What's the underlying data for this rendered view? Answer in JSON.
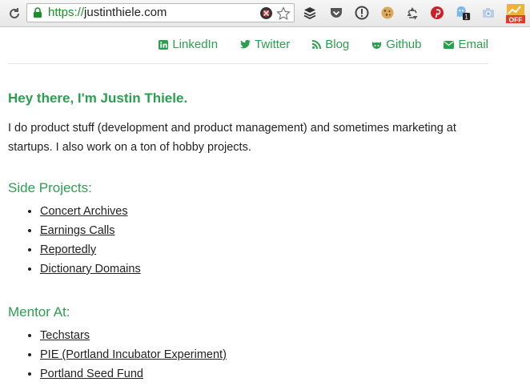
{
  "browser": {
    "url_scheme": "https://",
    "url_host": "justinthiele.com",
    "extensions": [
      {
        "name": "buffer-icon"
      },
      {
        "name": "pocket-icon"
      },
      {
        "name": "info-icon"
      },
      {
        "name": "cookie-icon"
      },
      {
        "name": "recycle-icon"
      },
      {
        "name": "pinterest-icon"
      },
      {
        "name": "ghost-icon",
        "badge": "1"
      },
      {
        "name": "camera-icon"
      },
      {
        "name": "chart-off-icon",
        "badge": "OFF"
      }
    ]
  },
  "nav": {
    "linkedin": "LinkedIn",
    "twitter": "Twitter",
    "blog": "Blog",
    "github": "Github",
    "email": "Email"
  },
  "colors": {
    "accent": "#2a9f4e",
    "url_scheme": "#1a8f2a"
  },
  "hero": {
    "heading": "Hey there, I'm Justin Thiele.",
    "intro": "I do product stuff (development and product management) and sometimes marketing at startups. I also work on a ton of hobby projects."
  },
  "side_projects": {
    "title": "Side Projects:",
    "items": [
      "Concert Archives",
      "Earnings Calls",
      "Reportedly",
      "Dictionary Domains"
    ]
  },
  "mentor": {
    "title": "Mentor At:",
    "items": [
      "Techstars",
      "PIE (Portland Incubator Experiment)",
      "Portland Seed Fund"
    ]
  }
}
